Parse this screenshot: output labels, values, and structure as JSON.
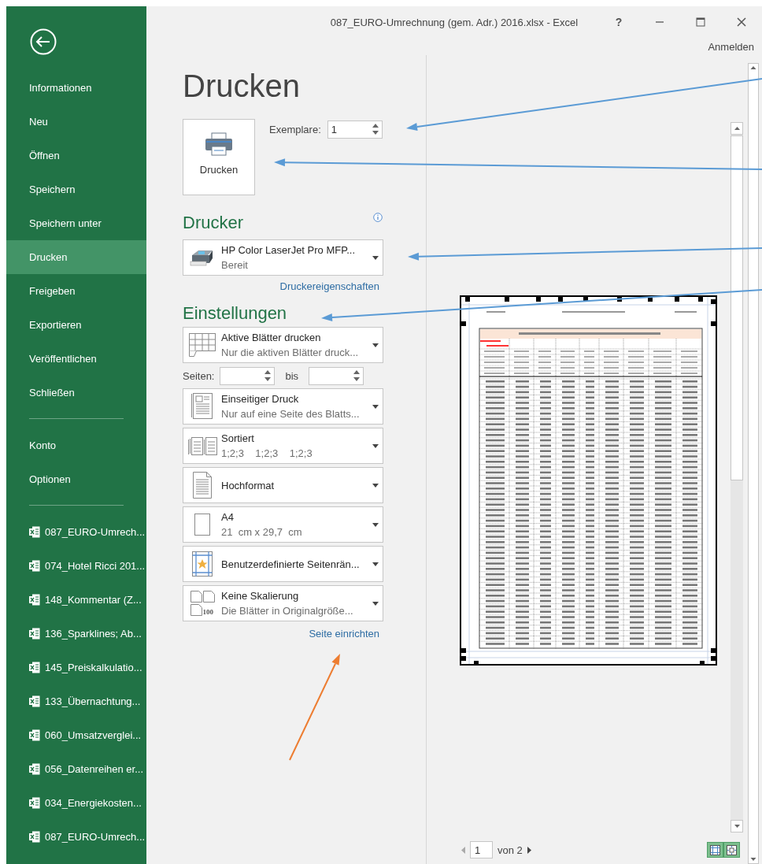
{
  "window": {
    "title": "087_EURO-Umrechnung (gem. Adr.) 2016.xlsx - Excel",
    "help": "?",
    "sign_in": "Anmelden"
  },
  "sidebar": {
    "items": [
      {
        "label": "Informationen",
        "selected": false
      },
      {
        "label": "Neu",
        "selected": false
      },
      {
        "label": "Öffnen",
        "selected": false
      },
      {
        "label": "Speichern",
        "selected": false
      },
      {
        "label": "Speichern unter",
        "selected": false
      },
      {
        "label": "Drucken",
        "selected": true
      },
      {
        "label": "Freigeben",
        "selected": false
      },
      {
        "label": "Exportieren",
        "selected": false
      },
      {
        "label": "Veröffentlichen",
        "selected": false
      },
      {
        "label": "Schließen",
        "selected": false
      }
    ],
    "secondary": [
      {
        "label": "Konto",
        "selected": false
      },
      {
        "label": "Optionen",
        "selected": false
      }
    ],
    "recent": [
      "087_EURO-Umrech...",
      "074_Hotel Ricci 201...",
      "148_Kommentar (Z...",
      "136_Sparklines; Ab...",
      "145_Preiskalkulatio...",
      "133_Übernachtung...",
      "060_Umsatzverglei...",
      "056_Datenreihen er...",
      "034_Energiekosten...",
      "087_EURO-Umrech..."
    ]
  },
  "print": {
    "heading": "Drucken",
    "button": "Drucken",
    "copies_label": "Exemplare:",
    "copies": "1"
  },
  "printer": {
    "heading": "Drucker",
    "name": "HP Color LaserJet Pro MFP...",
    "status": "Bereit",
    "link": "Druckereigenschaften"
  },
  "settings": {
    "heading": "Einstellungen",
    "items": [
      {
        "kind": "sheets",
        "title": "Aktive Blätter drucken",
        "subtitle": "Nur die aktiven Blätter druck..."
      },
      {
        "kind": "pages",
        "label": "Seiten:",
        "to": "bis"
      },
      {
        "kind": "sides",
        "title": "Einseitiger Druck",
        "subtitle": "Nur auf eine Seite des Blatts..."
      },
      {
        "kind": "collate",
        "title": "Sortiert",
        "subtitle": "1;2;3    1;2;3    1;2;3"
      },
      {
        "kind": "orientation",
        "title": "Hochformat"
      },
      {
        "kind": "paper",
        "title": "A4",
        "subtitle": "21  cm x 29,7  cm"
      },
      {
        "kind": "margins",
        "title": "Benutzerdefinierte Seitenrän..."
      },
      {
        "kind": "scaling",
        "title": "Keine Skalierung",
        "subtitle": "Die Blätter in Originalgröße...",
        "icon_text": "100"
      }
    ],
    "link": "Seite einrichten"
  },
  "preview": {
    "page": "1",
    "page_count": "von 2"
  },
  "annotations": [
    {
      "color": "#5b9bd5"
    },
    {
      "color": "#5b9bd5"
    },
    {
      "color": "#5b9bd5"
    },
    {
      "color": "#5b9bd5"
    },
    {
      "color": "#ed7d31"
    }
  ]
}
